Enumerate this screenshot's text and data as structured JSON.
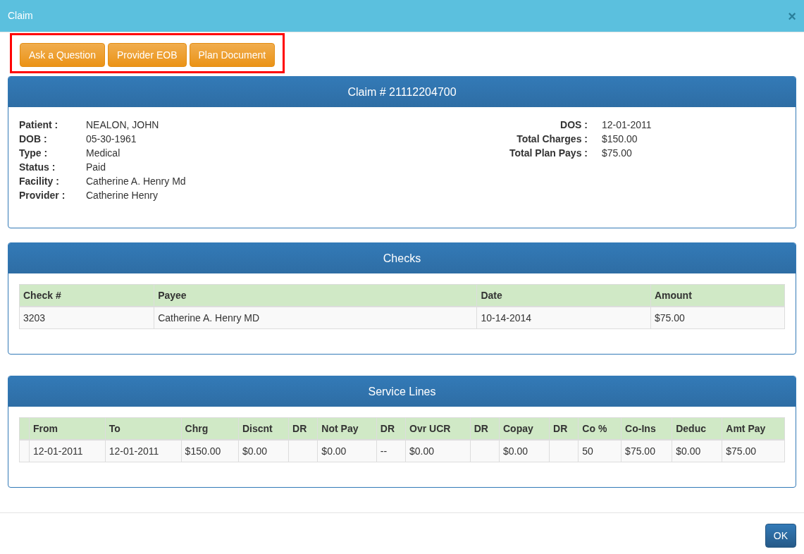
{
  "window": {
    "title": "Claim",
    "close": "×"
  },
  "toolbar": {
    "highlighted": true,
    "buttons": [
      "Ask a Question",
      "Provider EOB",
      "Plan Document"
    ]
  },
  "claim": {
    "title": "Claim # 21112204700",
    "left": [
      {
        "label": "Patient :",
        "value": "NEALON, JOHN"
      },
      {
        "label": "DOB :",
        "value": "05-30-1961"
      },
      {
        "label": "Type :",
        "value": "Medical"
      },
      {
        "label": "Status :",
        "value": "Paid"
      },
      {
        "label": "Facility :",
        "value": "Catherine A. Henry Md"
      },
      {
        "label": "Provider :",
        "value": "Catherine Henry"
      }
    ],
    "right": [
      {
        "label": "DOS :",
        "value": "12-01-2011"
      },
      {
        "label": "Total Charges :",
        "value": "$150.00"
      },
      {
        "label": "Total Plan Pays :",
        "value": "$75.00"
      }
    ]
  },
  "checks": {
    "title": "Checks",
    "marker_column": false,
    "columns": [
      "Check #",
      "Payee",
      "Date",
      "Amount"
    ],
    "rows": [
      [
        "3203",
        "Catherine A. Henry MD",
        "10-14-2014",
        "$75.00"
      ]
    ]
  },
  "service_lines": {
    "title": "Service Lines",
    "marker_column": true,
    "columns": [
      "From",
      "To",
      "Chrg",
      "Discnt",
      "DR",
      "Not Pay",
      "DR",
      "Ovr UCR",
      "DR",
      "Copay",
      "DR",
      "Co %",
      "Co-Ins",
      "Deduc",
      "Amt Pay"
    ],
    "rows": [
      [
        "12-01-2011",
        "12-01-2011",
        "$150.00",
        "$0.00",
        null,
        "$0.00",
        "--",
        "$0.00",
        null,
        "$0.00",
        null,
        "50",
        "$75.00",
        "$0.00",
        "$75.00"
      ]
    ]
  },
  "footer": {
    "buttons": [
      "OK"
    ]
  }
}
